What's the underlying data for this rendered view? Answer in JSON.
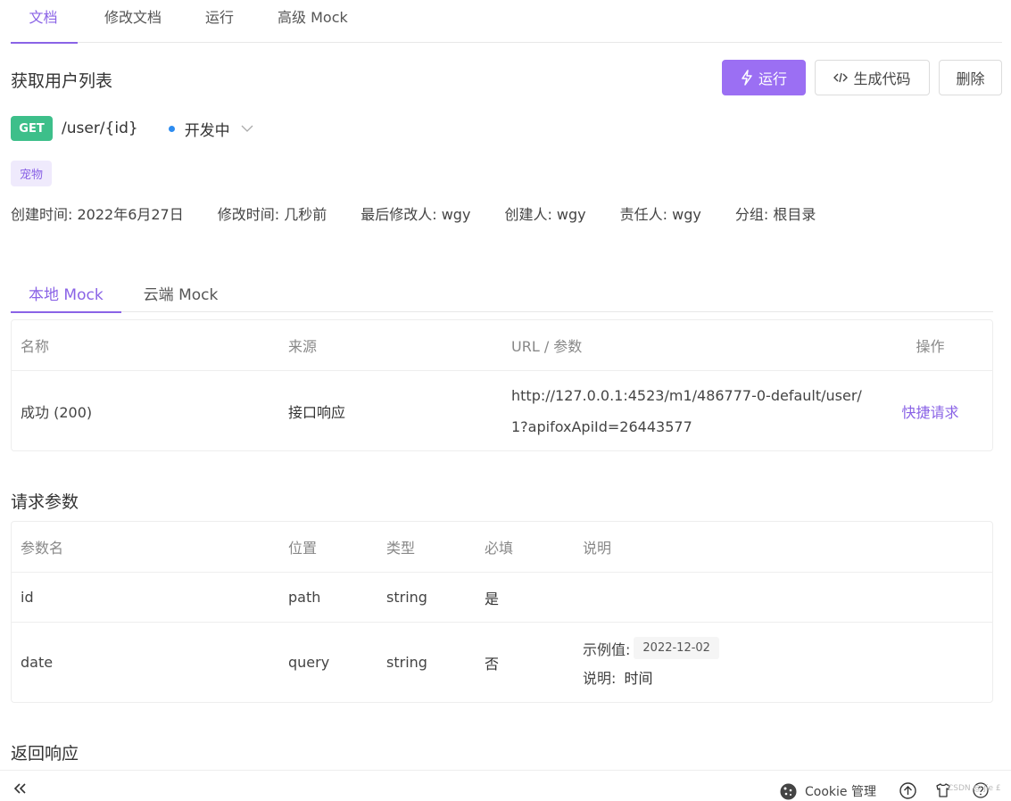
{
  "tabs": [
    "文档",
    "修改文档",
    "运行",
    "高级 Mock"
  ],
  "title": "获取用户列表",
  "actions": {
    "run": "运行",
    "gen_code": "生成代码",
    "delete": "删除"
  },
  "method": "GET",
  "path": "/user/{id}",
  "status": "开发中",
  "tag": "宠物",
  "meta": {
    "created": "创建时间: 2022年6月27日",
    "modified": "修改时间: 几秒前",
    "last_editor": "最后修改人: wgy",
    "creator": "创建人: wgy",
    "owner": "责任人: wgy",
    "group": "分组: 根目录"
  },
  "mock_tabs": [
    "本地 Mock",
    "云端 Mock"
  ],
  "mock_table": {
    "headers": [
      "名称",
      "来源",
      "URL / 参数",
      "操作"
    ],
    "row": {
      "name": "成功 (200)",
      "source": "接口响应",
      "url_line1": "http://127.0.0.1:4523/m1/486777-0-default/user/",
      "url_line2": "1?apifoxApiId=26443577",
      "action": "快捷请求"
    }
  },
  "params_title": "请求参数",
  "params_table": {
    "headers": [
      "参数名",
      "位置",
      "类型",
      "必填",
      "说明"
    ],
    "rows": [
      {
        "name": "id",
        "location": "path",
        "type": "string",
        "required": "是"
      },
      {
        "name": "date",
        "location": "query",
        "type": "string",
        "required": "否",
        "example_label": "示例值:",
        "example_value": "2022-12-02",
        "desc_label": "说明:",
        "desc_value": "时间"
      }
    ]
  },
  "response_title": "返回响应",
  "footer": {
    "cookie": "Cookie 管理",
    "watermark": "CSDN @ Jie £"
  },
  "colors": {
    "accent": "#8a63e6",
    "primary_btn": "#9b6ff3",
    "get": "#3dbf8a",
    "status_dot": "#2d8cf0"
  }
}
